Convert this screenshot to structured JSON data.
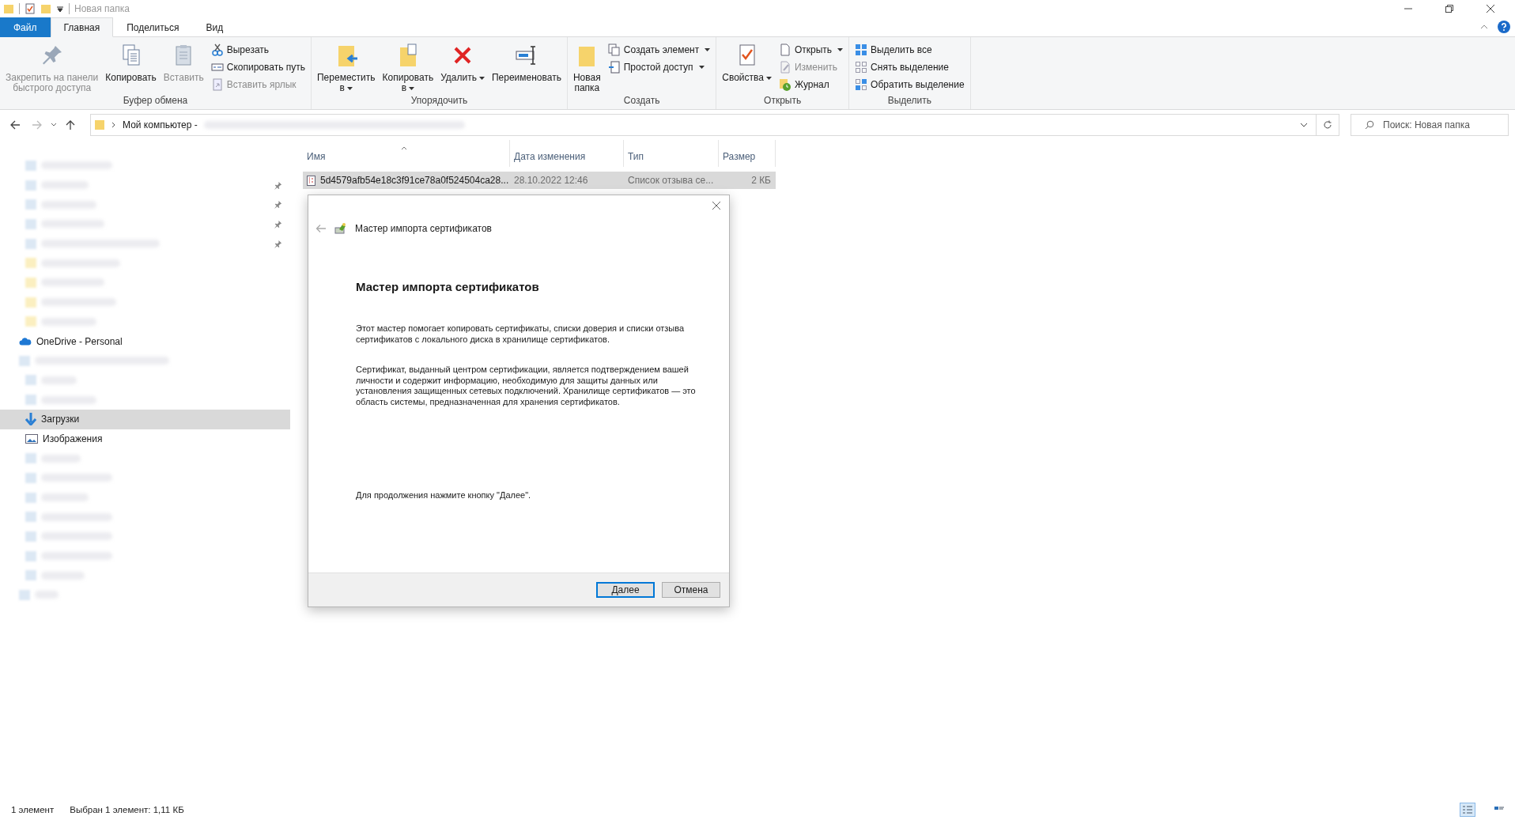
{
  "window": {
    "title": "Новая папка"
  },
  "ribbon_tabs": [
    {
      "label": "Файл",
      "kind": "file",
      "selected": false
    },
    {
      "label": "Главная",
      "kind": "tab",
      "selected": true
    },
    {
      "label": "Поделиться",
      "kind": "tab",
      "selected": false
    },
    {
      "label": "Вид",
      "kind": "tab",
      "selected": false
    }
  ],
  "ribbon_groups": [
    {
      "label": "Буфер обмена",
      "commands": [
        {
          "label": "Закрепить на панели\nбыстрого доступа",
          "kind": "large",
          "disabled": true
        },
        {
          "label": "Копировать",
          "kind": "large",
          "disabled": false
        },
        {
          "label": "Вставить",
          "kind": "large",
          "disabled": true
        },
        {
          "label": "Вырезать",
          "kind": "small",
          "disabled": false
        },
        {
          "label": "Скопировать путь",
          "kind": "small",
          "disabled": false
        },
        {
          "label": "Вставить ярлык",
          "kind": "small",
          "disabled": true
        }
      ]
    },
    {
      "label": "Упорядочить",
      "commands": [
        {
          "label": "Переместить\nв",
          "kind": "large",
          "disabled": false,
          "dropdown": true
        },
        {
          "label": "Копировать\nв",
          "kind": "large",
          "disabled": false,
          "dropdown": true
        },
        {
          "label": "Удалить",
          "kind": "large",
          "disabled": false,
          "dropdown": true
        },
        {
          "label": "Переименовать",
          "kind": "large",
          "disabled": false
        }
      ]
    },
    {
      "label": "Создать",
      "commands": [
        {
          "label": "Новая\nпапка",
          "kind": "large",
          "disabled": false
        },
        {
          "label": "Создать элемент",
          "kind": "small",
          "disabled": false,
          "dropdown": true
        },
        {
          "label": "Простой доступ",
          "kind": "small",
          "disabled": false,
          "dropdown": true
        }
      ]
    },
    {
      "label": "Открыть",
      "commands": [
        {
          "label": "Свойства",
          "kind": "large",
          "disabled": false,
          "dropdown": true
        },
        {
          "label": "Открыть",
          "kind": "small",
          "disabled": false,
          "dropdown": true
        },
        {
          "label": "Изменить",
          "kind": "small",
          "disabled": true
        },
        {
          "label": "Журнал",
          "kind": "small",
          "disabled": false
        }
      ]
    },
    {
      "label": "Выделить",
      "commands": [
        {
          "label": "Выделить все",
          "kind": "small",
          "disabled": false
        },
        {
          "label": "Снять выделение",
          "kind": "small",
          "disabled": false
        },
        {
          "label": "Обратить выделение",
          "kind": "small",
          "disabled": false
        }
      ]
    }
  ],
  "address_bar": {
    "path": "Мой компьютер -"
  },
  "search": {
    "placeholder": "Поиск: Новая папка"
  },
  "sidebar": {
    "items": [
      {
        "kind": "blurred",
        "pinned": false,
        "selected": false
      },
      {
        "kind": "blurred",
        "pinned": true,
        "selected": false
      },
      {
        "kind": "blurred",
        "pinned": true,
        "selected": false
      },
      {
        "kind": "blurred",
        "pinned": true,
        "selected": false
      },
      {
        "kind": "blurred",
        "pinned": true,
        "selected": false
      },
      {
        "kind": "blurred-folder",
        "pinned": false,
        "selected": false
      },
      {
        "kind": "blurred-folder",
        "pinned": false,
        "selected": false
      },
      {
        "kind": "blurred-folder",
        "pinned": false,
        "selected": false
      },
      {
        "kind": "blurred-folder",
        "pinned": false,
        "selected": false
      },
      {
        "kind": "cloud",
        "label": "OneDrive - Personal",
        "pinned": false,
        "selected": false
      },
      {
        "kind": "blurred-root",
        "pinned": false,
        "selected": false
      },
      {
        "kind": "blurred",
        "pinned": false,
        "selected": false
      },
      {
        "kind": "blurred",
        "pinned": false,
        "selected": false
      },
      {
        "kind": "downloads",
        "label": "Загрузки",
        "pinned": false,
        "selected": true
      },
      {
        "kind": "pictures",
        "label": "Изображения",
        "pinned": false,
        "selected": false
      },
      {
        "kind": "blurred",
        "pinned": false,
        "selected": false
      },
      {
        "kind": "blurred",
        "pinned": false,
        "selected": false
      },
      {
        "kind": "blurred",
        "pinned": false,
        "selected": false
      },
      {
        "kind": "blurred",
        "pinned": false,
        "selected": false
      },
      {
        "kind": "blurred",
        "pinned": false,
        "selected": false
      },
      {
        "kind": "blurred",
        "pinned": false,
        "selected": false
      },
      {
        "kind": "blurred",
        "pinned": false,
        "selected": false
      },
      {
        "kind": "blurred-root",
        "pinned": false,
        "selected": false
      }
    ]
  },
  "file_list": {
    "columns": [
      "Имя",
      "Дата изменения",
      "Тип",
      "Размер"
    ],
    "rows": [
      {
        "name": "5d4579afb54e18c3f91ce78a0f524504ca28...",
        "date": "28.10.2022 12:46",
        "type": "Список отзыва се...",
        "size": "2 КБ",
        "selected": true
      }
    ]
  },
  "dialog": {
    "title": "Мастер импорта сертификатов",
    "heading": "Мастер импорта сертификатов",
    "paragraphs": [
      "Этот мастер помогает копировать сертификаты, списки доверия и списки отзыва сертификатов с локального диска в хранилище сертификатов.",
      "Сертификат, выданный центром сертификации, является подтверждением вашей личности и содержит информацию, необходимую для защиты данных или установления защищенных сетевых подключений. Хранилище сертификатов — это область системы, предназначенная для хранения сертификатов."
    ],
    "prompt": "Для продолжения нажмите кнопку \"Далее\".",
    "buttons": [
      {
        "label": "Далее",
        "default": true
      },
      {
        "label": "Отмена",
        "default": false
      }
    ]
  },
  "status_bar": {
    "items": [
      "1 элемент",
      "Выбран 1 элемент: 1,11 КБ"
    ],
    "views": [
      {
        "kind": "details",
        "selected": true
      },
      {
        "kind": "tiles",
        "selected": false
      }
    ]
  }
}
